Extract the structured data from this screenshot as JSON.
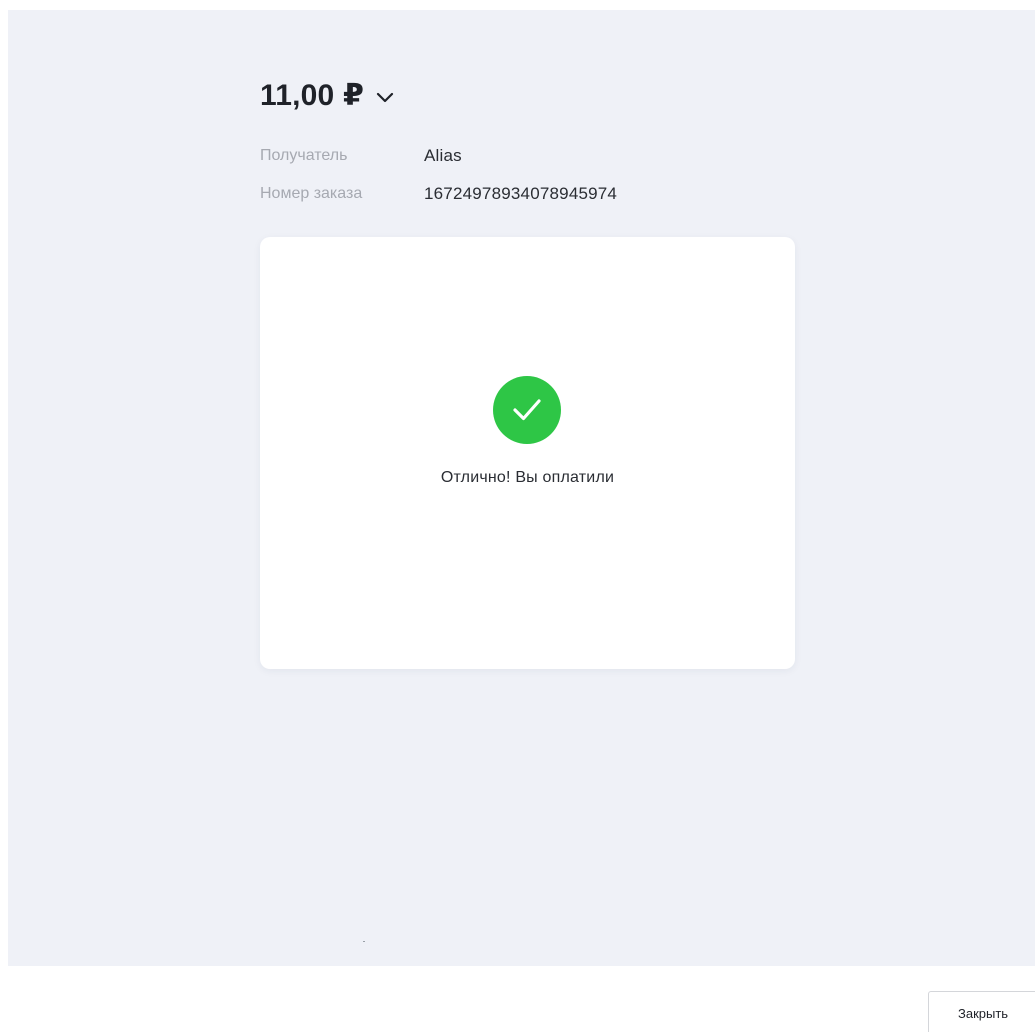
{
  "payment": {
    "amount": "11,00 ₽",
    "recipient_label": "Получатель",
    "recipient_value": "Alias",
    "order_label": "Номер заказа",
    "order_value": "16724978934078945974"
  },
  "status": {
    "message": "Отлично! Вы оплатили",
    "icon": "check-circle-icon",
    "color": "#2ec646"
  },
  "footer": {
    "close_label": "Закрыть"
  },
  "colors": {
    "panel_background": "#eff1f7",
    "card_background": "#ffffff",
    "label_text": "#a6a9b1",
    "primary_text": "#1f2229"
  }
}
